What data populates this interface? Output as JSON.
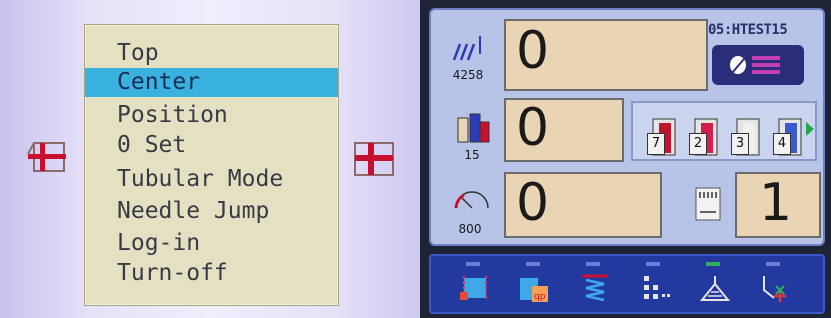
{
  "menu": {
    "items": [
      {
        "label": "Top",
        "selected": false
      },
      {
        "label": "Center",
        "selected": true
      },
      {
        "label": "Position",
        "selected": false
      },
      {
        "label": "0 Set",
        "selected": false
      },
      {
        "label": "Tubular Mode",
        "selected": false
      },
      {
        "label": "Needle Jump",
        "selected": false
      },
      {
        "label": "Log-in",
        "selected": false
      },
      {
        "label": "Turn-off",
        "selected": false
      }
    ]
  },
  "status": {
    "stitch_value": "0",
    "stitch_count": "4258",
    "color_value": "0",
    "color_count": "15",
    "speed_value": "0",
    "speed_count": "800",
    "design_name": "05:HTEST15",
    "needle_value": "1"
  },
  "spools": [
    {
      "number": "7",
      "color": "#c2142a"
    },
    {
      "number": "2",
      "color": "#d41d4d"
    },
    {
      "number": "3",
      "color": "#f0f0f0"
    },
    {
      "number": "4",
      "color": "#3a5bd0"
    }
  ],
  "toolbar": {
    "icons": [
      "frame-move-icon",
      "pattern-repeat-icon",
      "spring-icon",
      "grid-layout-icon",
      "trace-icon",
      "needle-icon"
    ]
  },
  "colors": {
    "selection": "#39b2e0",
    "menu_bg": "#e4e1c3",
    "value_bg": "#e9d5b4",
    "panel_bg": "#b7c4e8",
    "toolbar_bg": "#223aa0"
  }
}
